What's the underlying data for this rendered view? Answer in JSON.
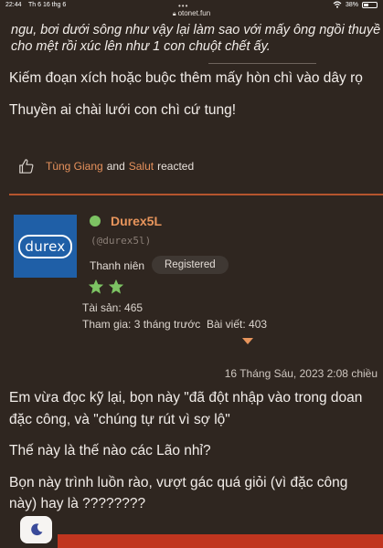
{
  "status_bar": {
    "time": "22:44",
    "date": "Th 6 16 thg 6",
    "url": "otonet.fun",
    "battery": "38%",
    "battery_level": 0.38
  },
  "quote_lines": [
    "ngu, bơi dưới sông như vậy lại làm sao với mấy ông ngồi thuyề",
    "cho mệt rồi xúc lên như 1 con chuột chết ấy."
  ],
  "reply_lines": [
    "Kiếm đoạn xích hoặc buộc thêm mấy hòn chì vào dây rọ",
    "Thuyền ai chài lưới con chì cứ tung!"
  ],
  "reactions": {
    "user1": "Tùng Giang",
    "and": "and",
    "user2": "Salut",
    "suffix": "reacted"
  },
  "author": {
    "avatar_text": "durex",
    "name": "Durex5L",
    "handle": "(@durex5l)",
    "rank": "Thanh niên",
    "badge": "Registered",
    "stars": 2,
    "assets": "Tài sản: 465",
    "joined": "Tham gia: 3 tháng trước",
    "posts": "Bài viết: 403"
  },
  "post": {
    "date": "16 Tháng Sáu, 2023 2:08 chiều",
    "paragraphs": [
      [
        "Em vừa đọc kỹ lại, bọn này \"đã đột nhập vào trong doan",
        "đặc công, và \"chúng tự rút vì sợ lộ\""
      ],
      [
        "Thế này là thế nào các Lão nhỉ?"
      ],
      [
        "Bọn này trình luồn rào, vượt gác quá giỏi (vì đặc công",
        "này) hay là ????????"
      ]
    ]
  },
  "colors": {
    "background": "#2f2620",
    "accent": "#e8955c",
    "divider": "#b5552d",
    "online": "#7dc363",
    "star": "#7dc363",
    "footer_bar": "#c0351f",
    "avatar_bg": "#1f5fa7"
  },
  "icons": {
    "reaction": "thumbs-up-icon",
    "online": "online-status-dot",
    "rating": "star-icon",
    "theme": "moon-icon",
    "secure": "lock-icon"
  }
}
